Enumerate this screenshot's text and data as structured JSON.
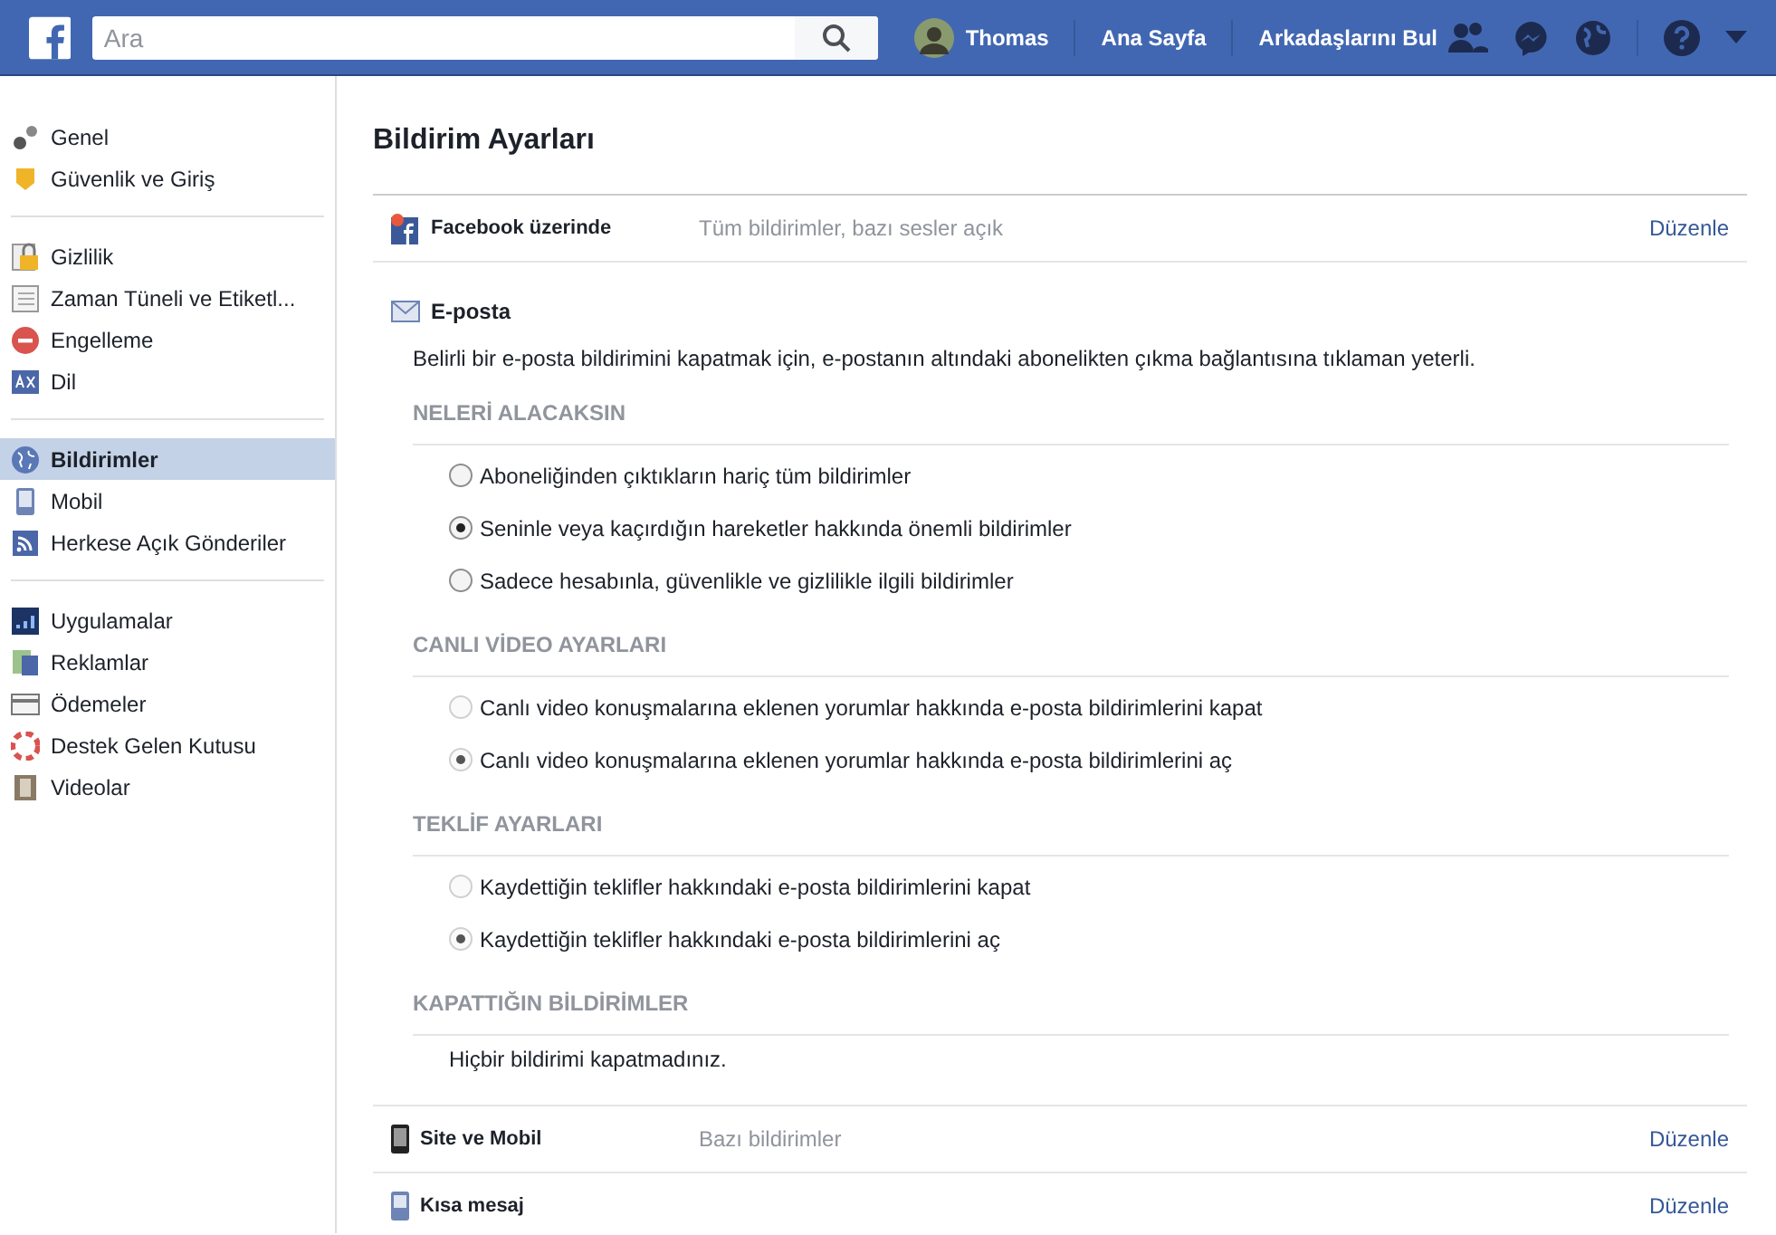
{
  "header": {
    "search": {
      "placeholder": "Ara"
    },
    "user": "Thomas",
    "links": [
      "Ana Sayfa",
      "Arkadaşlarını Bul"
    ]
  },
  "sidebar": {
    "groups": [
      [
        {
          "label": "Genel",
          "selected": false
        },
        {
          "label": "Güvenlik ve Giriş",
          "selected": false
        }
      ],
      [
        {
          "label": "Gizlilik",
          "selected": false
        },
        {
          "label": "Zaman Tüneli ve Etiketl...",
          "selected": false
        },
        {
          "label": "Engelleme",
          "selected": false
        },
        {
          "label": "Dil",
          "selected": false
        }
      ],
      [
        {
          "label": "Bildirimler",
          "selected": true
        },
        {
          "label": "Mobil",
          "selected": false
        },
        {
          "label": "Herkese Açık Gönderiler",
          "selected": false
        }
      ],
      [
        {
          "label": "Uygulamalar",
          "selected": false
        },
        {
          "label": "Reklamlar",
          "selected": false
        },
        {
          "label": "Ödemeler",
          "selected": false
        },
        {
          "label": "Destek Gelen Kutusu",
          "selected": false
        },
        {
          "label": "Videolar",
          "selected": false
        }
      ]
    ]
  },
  "page_title": "Bildirim Ayarları",
  "rows_top": [
    {
      "title": "Facebook üzerinde",
      "summary": "Tüm bildirimler, bazı sesler açık",
      "action": "Düzenle"
    }
  ],
  "email": {
    "title": "E-posta",
    "description": "Belirli bir e-posta bildirimini kapatmak için, e-postanın altındaki abonelikten çıkma bağlantısına tıklaman yeterli.",
    "sections": [
      {
        "heading": "NELERİ ALACAKSIN",
        "disabled": false,
        "options": [
          {
            "label": "Aboneliğinden çıktıkların hariç tüm bildirimler",
            "selected": false
          },
          {
            "label": "Seninle veya kaçırdığın hareketler hakkında önemli bildirimler",
            "selected": true
          },
          {
            "label": "Sadece hesabınla, güvenlikle ve gizlilikle ilgili bildirimler",
            "selected": false
          }
        ]
      },
      {
        "heading": "CANLI VİDEO AYARLARI",
        "disabled": true,
        "options": [
          {
            "label": "Canlı video konuşmalarına eklenen yorumlar hakkında e-posta bildirimlerini kapat",
            "selected": false
          },
          {
            "label": "Canlı video konuşmalarına eklenen yorumlar hakkında e-posta bildirimlerini aç",
            "selected": true
          }
        ]
      },
      {
        "heading": "TEKLİF AYARLARI",
        "disabled": true,
        "options": [
          {
            "label": "Kaydettiğin teklifler hakkındaki e-posta bildirimlerini kapat",
            "selected": false
          },
          {
            "label": "Kaydettiğin teklifler hakkındaki e-posta bildirimlerini aç",
            "selected": true
          }
        ]
      },
      {
        "heading": "KAPATTIĞIN BİLDİRİMLER",
        "text": "Hiçbir bildirimi kapatmadınız."
      }
    ]
  },
  "rows_bottom": [
    {
      "title": "Site ve Mobil",
      "summary": "Bazı bildirimler",
      "action": "Düzenle"
    },
    {
      "title": "Kısa mesaj",
      "action": "Düzenle"
    }
  ]
}
